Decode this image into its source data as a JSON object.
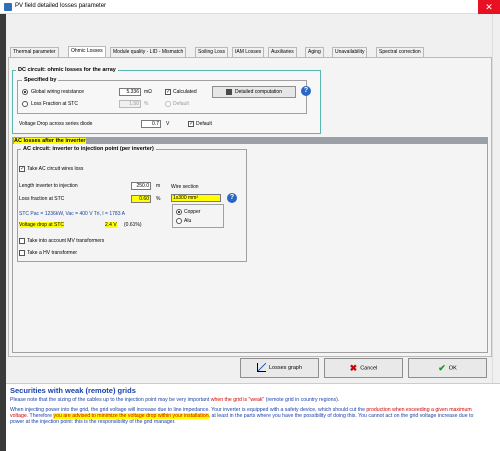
{
  "window": {
    "title": "PV field detailed losses parameter"
  },
  "tabs": [
    {
      "label": "Thermal parameter"
    },
    {
      "label": "Ohmic Losses"
    },
    {
      "label": "Module quality - LID - Mismatch"
    },
    {
      "label": "Soiling Loss"
    },
    {
      "label": "IAM Losses"
    },
    {
      "label": "Auxiliaries"
    },
    {
      "label": "Aging"
    },
    {
      "label": "Unavailability"
    },
    {
      "label": "Spectral correction"
    }
  ],
  "dc": {
    "title": "DC circuit: ohmic losses for the array",
    "specified_title": "Specified by",
    "global_label": "Global wiring resistance",
    "global_value": "5.336",
    "global_unit": "mΩ",
    "calculated_label": "Calculated",
    "loss_label": "Loss Fraction at STC",
    "loss_value": "1.50",
    "loss_unit": "%",
    "default_label": "Default",
    "detailed_button": "Detailed computation",
    "voltage_drop_label": "Voltage Drop across series diode",
    "voltage_drop_value": "0.7",
    "voltage_drop_unit": "V",
    "voltage_default_label": "Default"
  },
  "ac": {
    "header": "AC losses after the inverter",
    "inner_title": "AC circuit: inverter to injection point  (per inverter)",
    "use_ac_label": "Take AC circuit wires loss",
    "length_label": "Length inverter to injection",
    "length_value": "250.0",
    "length_unit": "m",
    "loss_label": "Loss fraction at STC",
    "loss_value": "0.60",
    "loss_unit": "%",
    "wire_section_label": "Wire section",
    "wire_section_value": "1x300 mm²",
    "copper_label": "Copper",
    "alu_label": "Alu",
    "stc_text": "STC Pac = 1236kW, Vac = 400 V Tri, I = 1783 A",
    "vdrop_label": "Voltage drop at STC",
    "vdrop_value": "2.4 V",
    "vdrop_pct": "(0.61%)",
    "mv_label": "Take into account MV transformers",
    "hv_label": "Take a HV transformer"
  },
  "buttons": {
    "losses_graph": "Losses graph",
    "cancel": "Cancel",
    "ok": "OK"
  },
  "helptext": {
    "title": "Securities with weak (remote) grids",
    "p1a": "Please note that the sizing of the cables up to the injection point may be very important ",
    "p1b": "when the grid is \"weak\"",
    "p1c": " (remote grid in country regions).",
    "p2a": "When injecting power into the grid, the grid voltage will increase due to line impedance. Your inverter is equipped with a safety device, which should cut the ",
    "p2b": "production when exceeding a given maximum voltage",
    "p2c": ". Therefore ",
    "p2d": "you are advised to minimize the voltage drop within your installation",
    "p2e": ", at least in the parts where you have the possibility of doing this. You cannot act on the grid voltage increase due to power at the injection point: this is the responsibility of the grid manager."
  }
}
